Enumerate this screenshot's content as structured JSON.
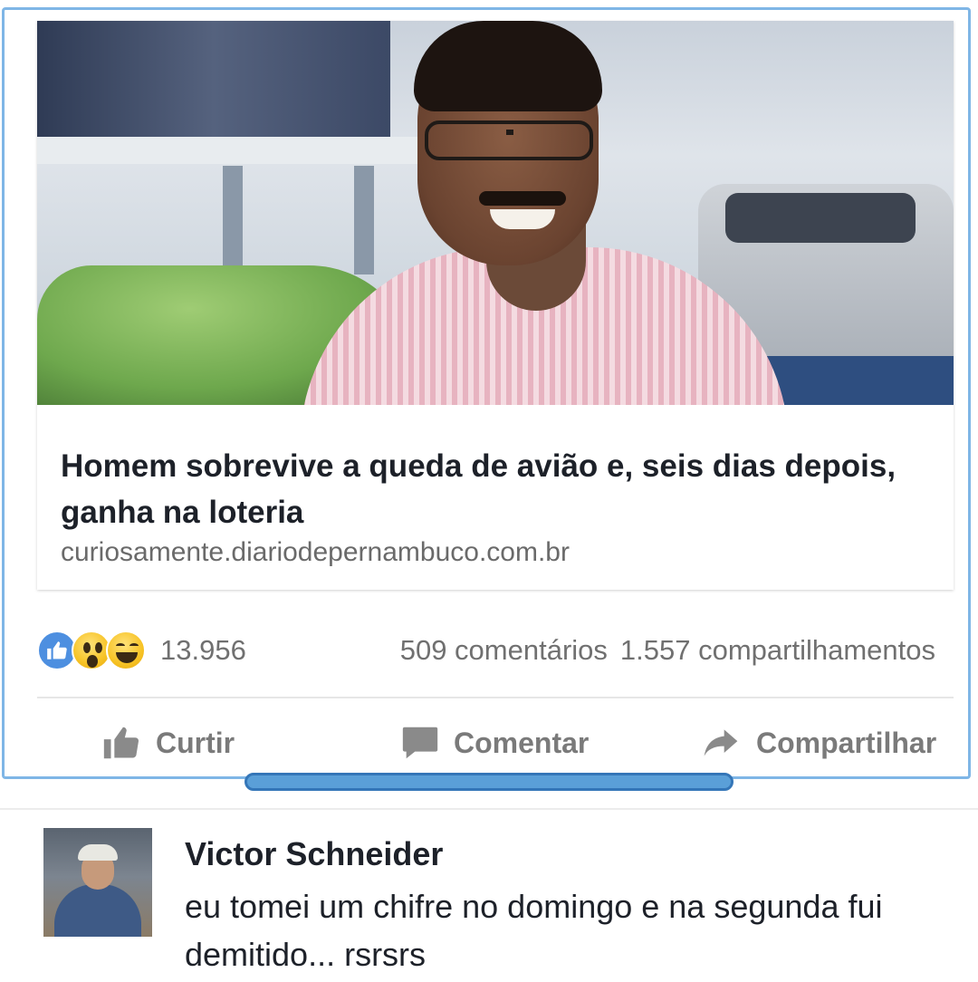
{
  "post": {
    "link_card": {
      "image_alt": "Homem sorridente de óculos e camisa listrada em uma oficina de carros",
      "headline": "Homem sobrevive a queda de avião e, seis dias depois, ganha na loteria",
      "domain": "curiosamente.diariodepernambuco.com.br"
    },
    "reactions": {
      "icons": [
        "like-icon",
        "wow-icon",
        "haha-icon"
      ],
      "count": "13.956"
    },
    "comments_count": "509 comentários",
    "shares_count": "1.557 compartilhamentos",
    "actions": {
      "like": "Curtir",
      "comment": "Comentar",
      "share": "Compartilhar"
    }
  },
  "comment": {
    "author": "Victor Schneider",
    "text": "eu tomei um chifre no domingo e na segunda fui demitido... rsrsrs"
  },
  "colors": {
    "frame_border": "#7fb6e6",
    "like_blue": "#4d8fe0",
    "scrollbar": "#5a9fd8",
    "headline_text": "#1d2129",
    "muted_text": "#707070"
  }
}
